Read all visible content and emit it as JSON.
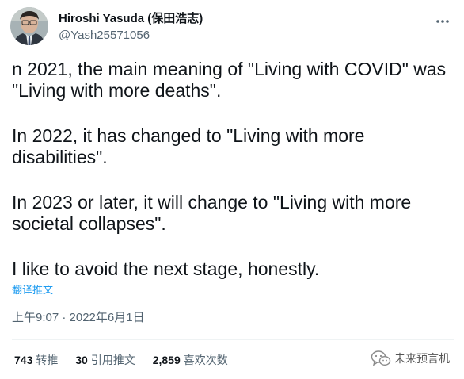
{
  "author": {
    "display_name": "Hiroshi Yasuda (保田浩志)",
    "handle": "@Yash25571056"
  },
  "tweet": {
    "paragraphs": [
      "n 2021, the main meaning of \"Living with COVID\" was \"Living with more deaths\".",
      "In 2022, it has changed to \"Living with more disabilities\".",
      "In 2023 or later, it will change to \"Living with more societal collapses\".",
      "I like to avoid the next stage, honestly."
    ],
    "translate_label": "翻译推文",
    "timestamp": "上午9:07 · 2022年6月1日"
  },
  "stats": {
    "retweets": {
      "count": "743",
      "label": "转推"
    },
    "quotes": {
      "count": "30",
      "label": "引用推文"
    },
    "likes": {
      "count": "2,859",
      "label": "喜欢次数"
    }
  },
  "watermark": {
    "text": "未来预言机"
  },
  "icons": {
    "more": "more-dots-icon",
    "watermark": "wechat-icon"
  },
  "colors": {
    "text": "#0f1419",
    "secondary": "#536471",
    "link": "#1d9bf0",
    "divider": "#eff3f4"
  }
}
